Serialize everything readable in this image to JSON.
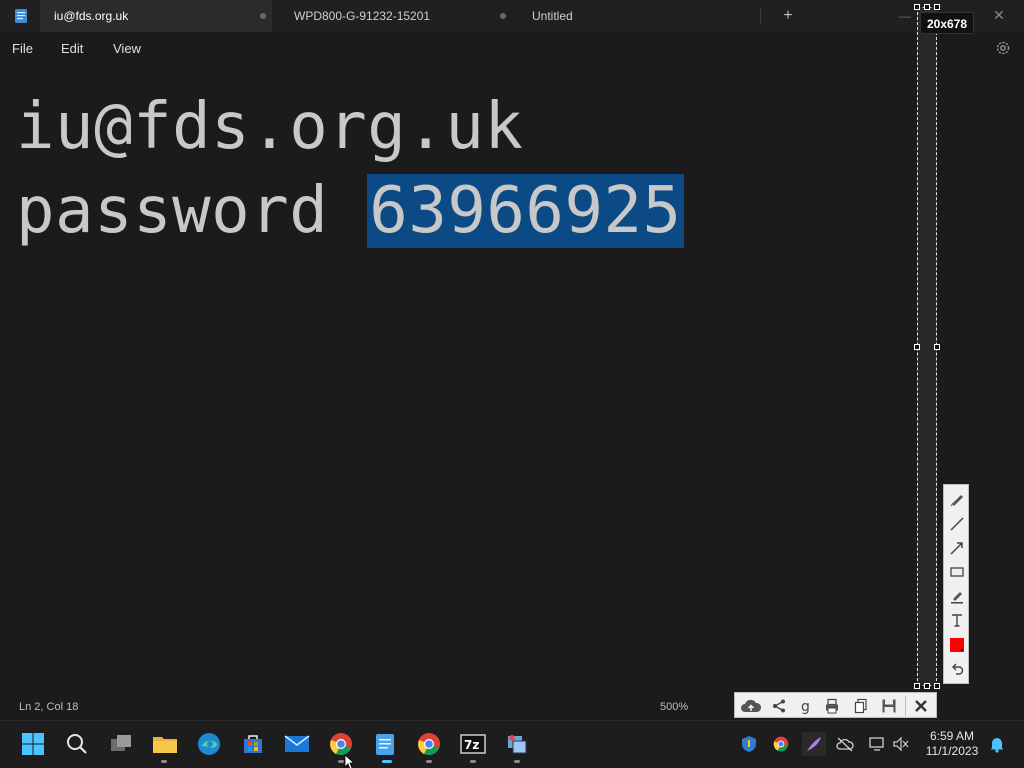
{
  "tabs": [
    {
      "label": "iu@fds.org.uk",
      "active": true
    },
    {
      "label": "WPD800-G-91232-15201",
      "active": false
    },
    {
      "label": "Untitled",
      "active": false
    }
  ],
  "menu": {
    "file": "File",
    "edit": "Edit",
    "view": "View"
  },
  "editor": {
    "line1": "iu@fds.org.uk",
    "line2_prefix": "password ",
    "line2_selected": "63966925"
  },
  "status": {
    "position": "Ln 2, Col 18",
    "zoom": "500%"
  },
  "overlay": {
    "size_label": "20x678"
  },
  "clock": {
    "time": "6:59 AM",
    "date": "11/1/2023"
  },
  "colors": {
    "selection": "#0c4a86",
    "background": "#1b1b1b",
    "accent": "#0078d4"
  },
  "icons": {
    "vertical_toolbar": [
      "pen-icon",
      "line-icon",
      "arrow-icon",
      "rectangle-icon",
      "marker-icon",
      "text-icon",
      "color-swatch-icon",
      "undo-icon"
    ],
    "horizontal_toolbar": [
      "cloud-upload-icon",
      "share-icon",
      "google-search-icon",
      "print-icon",
      "copy-icon",
      "save-icon",
      "close-icon"
    ],
    "taskbar": [
      "start-icon",
      "search-icon",
      "task-view-icon",
      "file-explorer-icon",
      "edge-icon",
      "store-icon",
      "mail-icon",
      "chrome-icon",
      "notepad-icon",
      "chrome-icon",
      "7zip-icon",
      "app-icon"
    ]
  }
}
